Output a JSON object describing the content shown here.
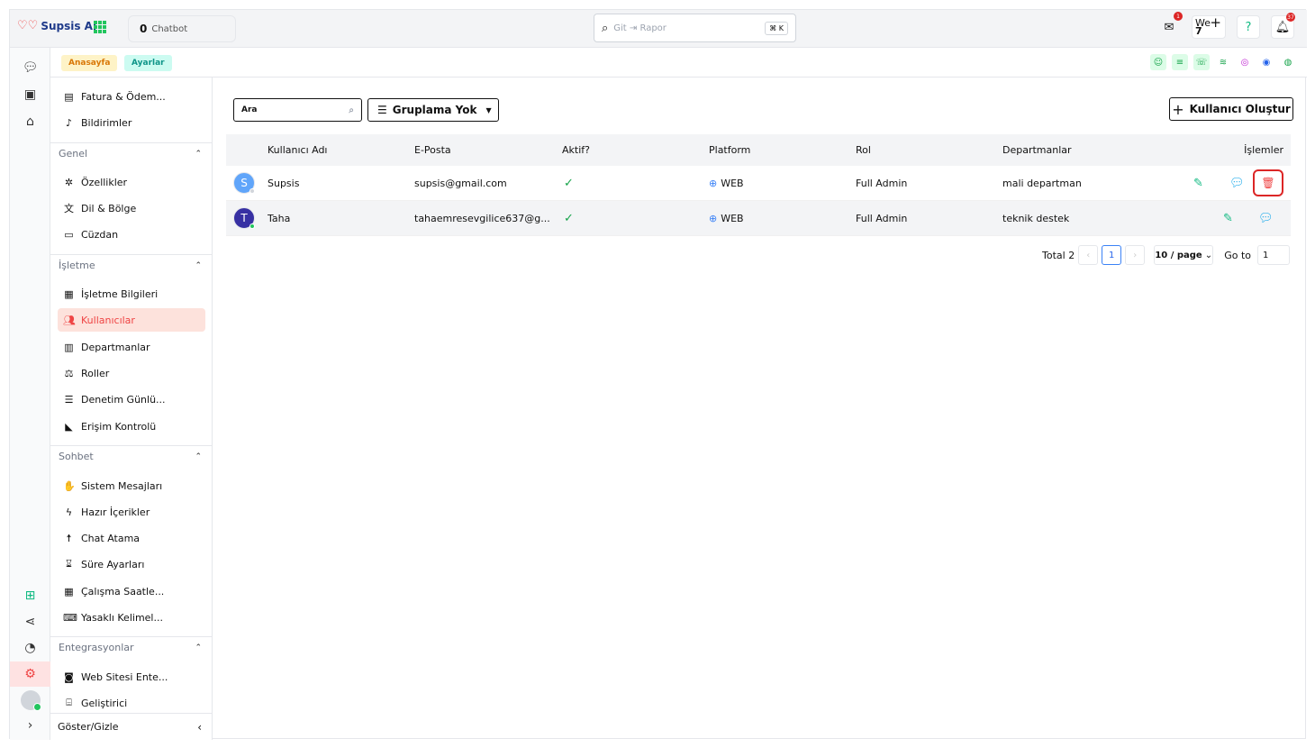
{
  "app": {
    "name": "Supsis Ai"
  },
  "topbar": {
    "chatbot_count": "0",
    "chatbot_label": "Chatbot",
    "search_placeholder": "Git ⇥ Rapor",
    "shortcut": "⌘ K",
    "mail_badge": "1",
    "we_label": "We",
    "we_count": "7",
    "notif_badge": "37"
  },
  "breadcrumb": {
    "home": "Anasayfa",
    "settings": "Ayarlar"
  },
  "sidebar": {
    "top_items": [
      {
        "label": "Fatura & Ödem...",
        "icon": "invoice-icon"
      },
      {
        "label": "Bildirimler",
        "icon": "bell-icon"
      }
    ],
    "groups": [
      {
        "title": "Genel",
        "items": [
          {
            "label": "Özellikler"
          },
          {
            "label": "Dil & Bölge"
          },
          {
            "label": "Cüzdan"
          }
        ]
      },
      {
        "title": "İşletme",
        "items": [
          {
            "label": "İşletme Bilgileri"
          },
          {
            "label": "Kullanıcılar"
          },
          {
            "label": "Departmanlar"
          },
          {
            "label": "Roller"
          },
          {
            "label": "Denetim Günlü..."
          },
          {
            "label": "Erişim Kontrolü"
          }
        ]
      },
      {
        "title": "Sohbet",
        "items": [
          {
            "label": "Sistem Mesajları"
          },
          {
            "label": "Hazır İçerikler"
          },
          {
            "label": "Chat Atama"
          },
          {
            "label": "Süre Ayarları"
          },
          {
            "label": "Çalışma Saatle..."
          },
          {
            "label": "Yasaklı Kelimel..."
          }
        ]
      },
      {
        "title": "Entegrasyonlar",
        "items": [
          {
            "label": "Web Sitesi Ente..."
          },
          {
            "label": "Geliştirici"
          }
        ]
      }
    ],
    "footer": "Göster/Gizle",
    "active": "Kullanıcılar"
  },
  "toolbar": {
    "search_value": "Ara",
    "group_label": "Gruplama Yok",
    "create_label": "Kullanıcı Oluştur"
  },
  "table": {
    "headers": [
      "Kullanıcı Adı",
      "E-Posta",
      "Aktif?",
      "Platform",
      "Rol",
      "Departmanlar",
      "İşlemler"
    ],
    "rows": [
      {
        "initial": "S",
        "name": "Supsis",
        "email": "supsis@gmail.com",
        "platform": "WEB",
        "role": "Full Admin",
        "department": "mali departman"
      },
      {
        "initial": "T",
        "name": "Taha",
        "email": "tahaemresevgilice637@g...",
        "platform": "WEB",
        "role": "Full Admin",
        "department": "teknik destek"
      }
    ]
  },
  "pagination": {
    "total": "Total 2",
    "current": "1",
    "page_size": "10 / page",
    "goto_label": "Go to",
    "goto_value": "1"
  },
  "colors": {
    "accent": "#ef4444",
    "active_bg": "#fde2dc",
    "edit": "#10b981",
    "chat": "#0ea5e9",
    "delete": "#dc2626"
  }
}
